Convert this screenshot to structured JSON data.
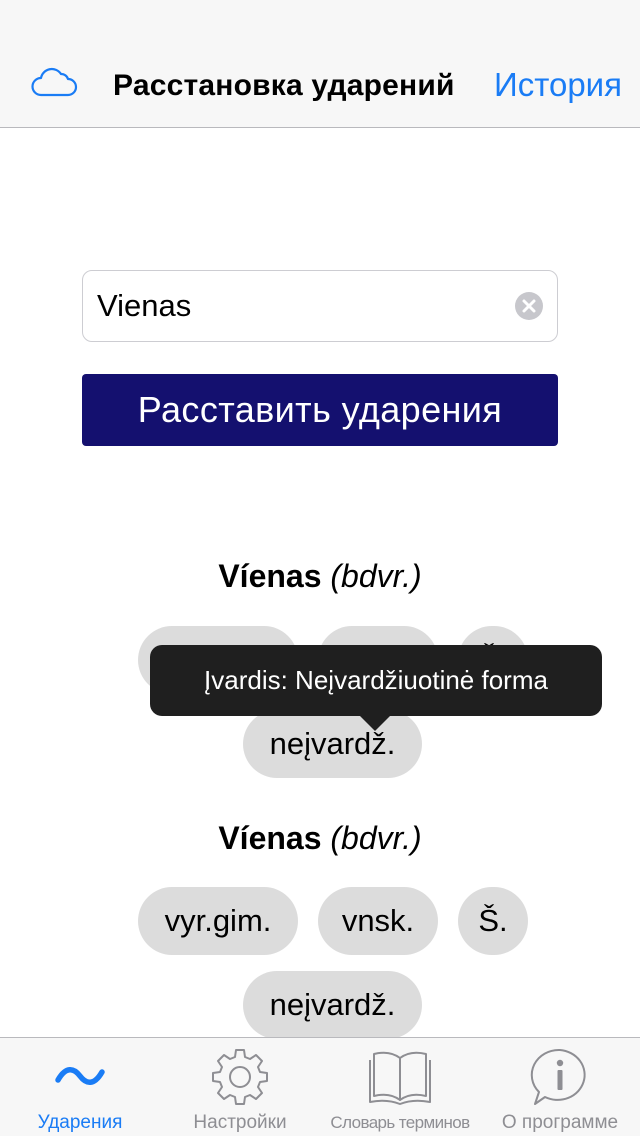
{
  "nav": {
    "title": "Расстановка ударений",
    "history_label": "История",
    "left_icon": "cloud-icon"
  },
  "search": {
    "value": "Vienas",
    "clear_icon": "clear-icon"
  },
  "actions": {
    "accent_label": "Расставить ударения"
  },
  "results": [
    {
      "word": "Víenas",
      "pos": "(bdvr.)",
      "tags": [
        "vyr.gim.",
        "vnsk.",
        "Š.",
        "neįvardž."
      ]
    },
    {
      "word": "Víenas",
      "pos": "(bdvr.)",
      "tags": [
        "vyr.gim.",
        "vnsk.",
        "Š.",
        "neįvardž."
      ]
    }
  ],
  "tooltip": {
    "text": "Įvardis: Neįvardžiuotinė forma"
  },
  "tabs": [
    {
      "label": "Ударения",
      "icon": "tilde-icon",
      "active": true
    },
    {
      "label": "Настройки",
      "icon": "gear-icon",
      "active": false
    },
    {
      "label": "Словарь терминов",
      "icon": "book-icon",
      "active": false
    },
    {
      "label": "О программе",
      "icon": "info-icon",
      "active": false
    }
  ],
  "colors": {
    "accent": "#1a7cf5",
    "button": "#14106f",
    "chip": "#dcdcdc",
    "tooltip": "#1f1f1f",
    "inactive_tab": "#8e8e93"
  }
}
